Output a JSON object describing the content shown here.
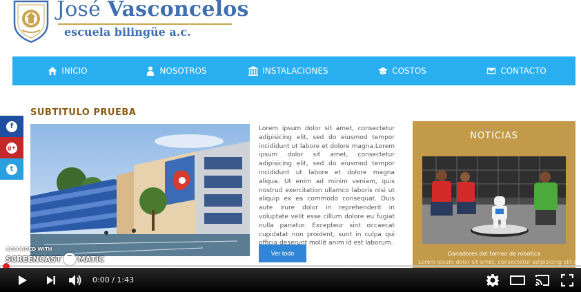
{
  "brand": {
    "name_first": "José",
    "name_last": "Vasconcelos",
    "tagline": "escuela bilingüe a.c."
  },
  "nav": {
    "items": [
      {
        "label": "INICIO",
        "icon": "home-icon"
      },
      {
        "label": "NOSOTROS",
        "icon": "user-icon"
      },
      {
        "label": "INSTALACIONES",
        "icon": "building-icon"
      },
      {
        "label": "COSTOS",
        "icon": "graduation-cap-icon"
      },
      {
        "label": "CONTACTO",
        "icon": "envelope-icon"
      }
    ],
    "color": "#29aef0"
  },
  "social": {
    "facebook": "f",
    "googleplus": "g+",
    "twitter": "t"
  },
  "main": {
    "subtitle": "SUBTITULO PRUEBA",
    "body": "Lorem ipsum dolor sit amet, consectetur adipisicing elit, sed do eiusmod tempor incididunt ut labore et dolore magna.Lorem ipsum dolor sit amet, consectetur adipisicing elit, sed do eiusmod tempor incididunt ut labore et dolore magna aliqua. Ut enim ad minim veniam, quis nostrud exercitation ullamco laboris nisi ut aliquip ex ea commodo consequat. Duis aute irure dolor in reprehenderit in voluptate velit esse cillum dolore eu fugiat nulla pariatur. Excepteur sint occaecat cupidatat non proident, sunt in culpa qui officia deserunt mollit anim id est laborum.",
    "button": "Ver todo"
  },
  "news": {
    "title": "NOTICIAS",
    "caption": "Ganadores del torneo de robotica",
    "excerpt": "Lorem ipsum dolor sit amet, consectetur adipisicing elit sed",
    "color": "#c39a49"
  },
  "watermark": {
    "top": "RECORDED WITH",
    "left": "SCREENCAST",
    "right": "MATIC"
  },
  "player": {
    "time": "0:00 / 1:43",
    "progress": 0.0
  }
}
